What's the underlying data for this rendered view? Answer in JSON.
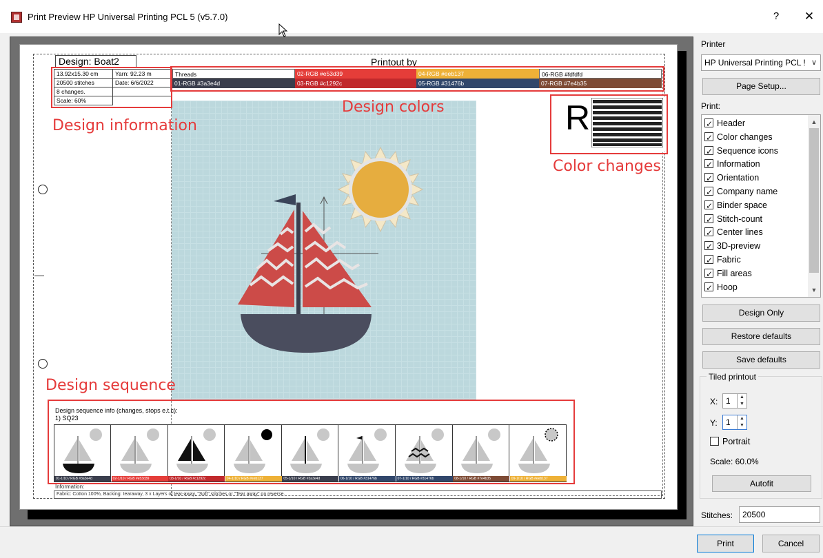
{
  "window": {
    "title": "Print Preview HP Universal Printing PCL 5 (v5.7.0)",
    "help": "?",
    "close": "✕"
  },
  "page": {
    "design_title": "Design: Boat2",
    "printout_by": "Printout by",
    "info": {
      "size": "13.92x15.30 cm",
      "yarn": "Yarn: 92.23 m",
      "stitches": "20500 stitches",
      "date": "Date: 6/6/2022",
      "changes": "8 changes.",
      "scale": "Scale: 60%"
    },
    "threads": {
      "label": "Threads",
      "cells": [
        {
          "text": "02-RGB #e53d39",
          "color": "#e53d39",
          "fg": "#ffffff"
        },
        {
          "text": "04-RGB #eeb137",
          "color": "#eeb137",
          "fg": "#ffffff"
        },
        {
          "text": "06-RGB #fdfdfd",
          "color": "#fdfdfd",
          "fg": "#000000"
        },
        {
          "text": "01-RGB #3a3e4d",
          "color": "#3a3e4d",
          "fg": "#ffffff"
        },
        {
          "text": "03-RGB #c1292c",
          "color": "#c1292c",
          "fg": "#ffffff"
        },
        {
          "text": "05-RGB #31476b",
          "color": "#31476b",
          "fg": "#ffffff"
        },
        {
          "text": "07-RGB #7e4b35",
          "color": "#7e4b35",
          "fg": "#ffffff"
        }
      ]
    },
    "color_changes_letter": "R",
    "sequence": {
      "info_line": "Design sequence info (changes, stops e.t.c):",
      "item": "1) SQ23",
      "bars": [
        "#3a3e4d",
        "#e53d39",
        "#c1292c",
        "#eeb137",
        "#3a3e4d",
        "#31476b",
        "#31476b",
        "#7e4b35",
        "#eeb137"
      ],
      "bar_texts": [
        "01-1/10 / RGB #3a3e4d",
        "02-1/10 / RGB #e53d39",
        "03-1/10 / RGB #c1292c",
        "04-1/10 / RGB #eeb137",
        "05-1/10 / RGB #3a3e4d",
        "06-1/10 / RGB #31476b",
        "07-1/10 / RGB #31476b",
        "08-1/10 / RGB #7e4b35",
        "09-1/10 / RGB #eeb137"
      ]
    },
    "information_label": "Information:",
    "information_text": "Fabric: Cotton 100%, Backing: tearaway, 3 x Layers of tear-away, \"Soft\" stitches or \"Tear away\" on reverse."
  },
  "annotations": {
    "design_information": "Design information",
    "design_colors": "Design colors",
    "color_changes": "Color changes",
    "design_sequence": "Design sequence"
  },
  "panel": {
    "printer_label": "Printer",
    "printer_value": "HP Universal Printing PCL !",
    "page_setup": "Page Setup...",
    "print_label": "Print:",
    "options": [
      {
        "label": "Header",
        "checked": true
      },
      {
        "label": "Color changes",
        "checked": true
      },
      {
        "label": "Sequence icons",
        "checked": true
      },
      {
        "label": "Information",
        "checked": true
      },
      {
        "label": "Orientation",
        "checked": true
      },
      {
        "label": "Company name",
        "checked": true
      },
      {
        "label": "Binder space",
        "checked": true
      },
      {
        "label": "Stitch-count",
        "checked": true
      },
      {
        "label": "Center lines",
        "checked": true
      },
      {
        "label": "3D-preview",
        "checked": true
      },
      {
        "label": "Fabric",
        "checked": true
      },
      {
        "label": "Fill areas",
        "checked": true
      },
      {
        "label": "Hoop",
        "checked": true
      }
    ],
    "design_only": "Design Only",
    "restore_defaults": "Restore defaults",
    "save_defaults": "Save defaults",
    "tiled_printout": "Tiled printout",
    "x_label": "X:",
    "x_value": "1",
    "y_label": "Y:",
    "y_value": "1",
    "portrait_label": "Portrait",
    "portrait_checked": false,
    "scale_text": "Scale:  60.0%",
    "autofit": "Autofit",
    "stitches_label": "Stitches:",
    "stitches_value": "20500",
    "print_button": "Print",
    "cancel_button": "Cancel"
  }
}
